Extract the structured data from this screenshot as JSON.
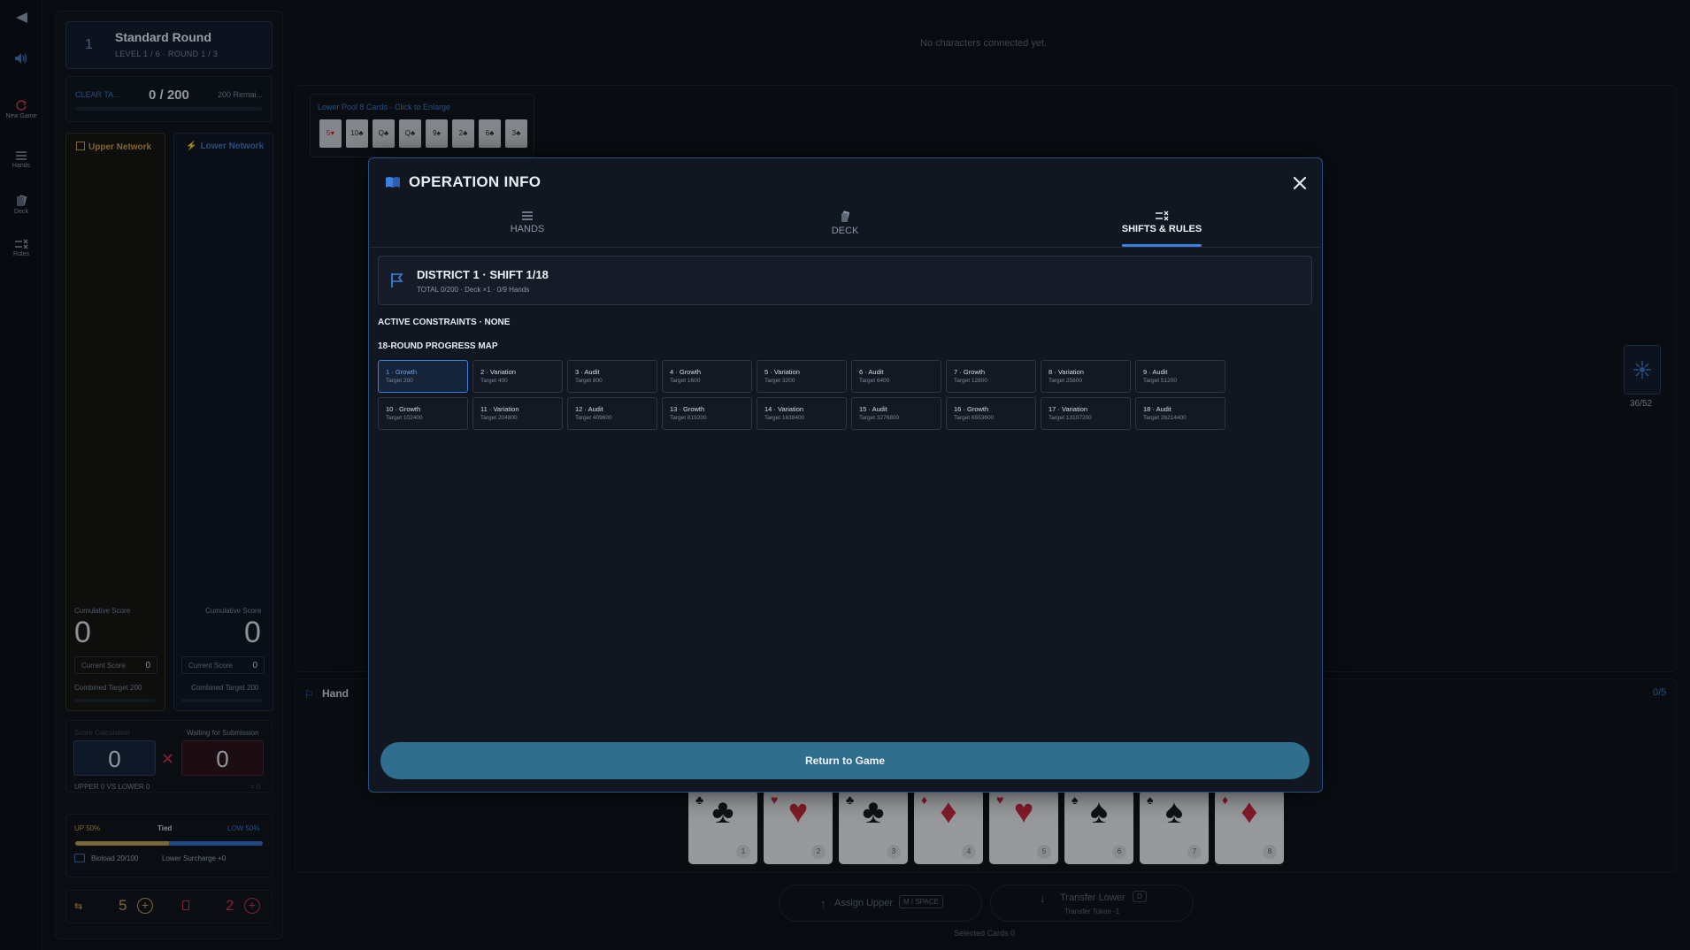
{
  "rail": [
    {
      "icon": "back-arrow-icon",
      "label": ""
    },
    {
      "icon": "volume-icon",
      "label": ""
    },
    {
      "icon": "new-game-icon",
      "label": "New Game"
    },
    {
      "icon": "hands-icon",
      "label": "Hands"
    },
    {
      "icon": "deck-icon",
      "label": "Deck"
    },
    {
      "icon": "rules-icon",
      "label": "Rules"
    }
  ],
  "round": {
    "number": "1",
    "title": "Standard Round",
    "subtitle": "LEVEL 1 / 6 · ROUND 1 / 3"
  },
  "target": {
    "label": "CLEAR TA...",
    "value": "0 / 200",
    "remaining": "200 Remai..."
  },
  "networks": {
    "upper": {
      "title": "Upper Network",
      "cum_label": "Cumulative Score",
      "cum_value": "0",
      "current_label": "Current Score",
      "current_value": "0",
      "combined": "Combined Target 200"
    },
    "lower": {
      "title": "Lower Network",
      "cum_label": "Cumulative Score",
      "cum_value": "0",
      "current_label": "Current Score",
      "current_value": "0",
      "combined": "Combined Target 200"
    }
  },
  "calc": {
    "label": "Score Calculation",
    "status": "Waiting for Submission",
    "left_value": "0",
    "right_value": "0",
    "vs_text": "UPPER 0  VS  LOWER 0",
    "right_small": "= 0"
  },
  "sway": {
    "up_label": "UP 50%",
    "mid_label": "Tied",
    "low_label": "LOW 50%",
    "up_fraction": 0.5,
    "bioload": "Bioload 20/100",
    "surcharge": "Lower Surcharge +0"
  },
  "resources": {
    "left_value": "5",
    "right_value": "2"
  },
  "board": {
    "no_chars": "No characters connected yet.",
    "pool_title": "Lower Pool 8 Cards · Click to Enlarge",
    "pool_cards": [
      "5♥",
      "10♣",
      "Q♣",
      "Q♣",
      "9♠",
      "2♣",
      "6♣",
      "3♣"
    ],
    "deck_count": "36/52",
    "hand_title": "Hand",
    "hand_count": "0/5",
    "assign_label": "Assign Upper",
    "assign_key": "M / SPACE",
    "transfer_label": "Transfer Lower",
    "transfer_key": "D",
    "transfer_sub": "Transfer Token -1",
    "selected": "Selected Cards 0"
  },
  "hand_cards": [
    {
      "suit": "♣",
      "color": "black",
      "index": "1"
    },
    {
      "suit": "♥",
      "color": "red",
      "index": "2"
    },
    {
      "suit": "♣",
      "color": "black",
      "index": "3"
    },
    {
      "suit": "♦",
      "color": "red",
      "index": "4"
    },
    {
      "suit": "♥",
      "color": "red",
      "index": "5"
    },
    {
      "suit": "♠",
      "color": "black",
      "index": "6"
    },
    {
      "suit": "♠",
      "color": "black",
      "index": "7"
    },
    {
      "suit": "♦",
      "color": "red",
      "index": "8"
    }
  ],
  "modal": {
    "title": "OPERATION INFO",
    "tabs": [
      {
        "label": "HANDS",
        "icon": "list-icon"
      },
      {
        "label": "DECK",
        "icon": "cards-icon"
      },
      {
        "label": "SHIFTS & RULES",
        "icon": "rules-icon"
      }
    ],
    "active_tab": 2,
    "district_title": "DISTRICT 1 · SHIFT 1/18",
    "district_sub": "TOTAL 0/200 · Deck ×1 · 0/9 Hands",
    "constraints": "ACTIVE CONSTRAINTS · NONE",
    "progress_title": "18-ROUND PROGRESS MAP",
    "return_label": "Return to Game",
    "shifts": [
      {
        "name": "1 · Growth",
        "target": "Target 200"
      },
      {
        "name": "2 · Variation",
        "target": "Target 400"
      },
      {
        "name": "3 · Audit",
        "target": "Target 800"
      },
      {
        "name": "4 · Growth",
        "target": "Target 1600"
      },
      {
        "name": "5 · Variation",
        "target": "Target 3200"
      },
      {
        "name": "6 · Audit",
        "target": "Target 6400"
      },
      {
        "name": "7 · Growth",
        "target": "Target 12800"
      },
      {
        "name": "8 · Variation",
        "target": "Target 25600"
      },
      {
        "name": "9 · Audit",
        "target": "Target 51200"
      },
      {
        "name": "10 · Growth",
        "target": "Target 102400"
      },
      {
        "name": "11 · Variation",
        "target": "Target 204800"
      },
      {
        "name": "12 · Audit",
        "target": "Target 409600"
      },
      {
        "name": "13 · Growth",
        "target": "Target 819200"
      },
      {
        "name": "14 · Variation",
        "target": "Target 1638400"
      },
      {
        "name": "15 · Audit",
        "target": "Target 3276800"
      },
      {
        "name": "16 · Growth",
        "target": "Target 6553600"
      },
      {
        "name": "17 · Variation",
        "target": "Target 13107200"
      },
      {
        "name": "18 · Audit",
        "target": "Target 26214400"
      }
    ]
  },
  "colors": {
    "accent": "#3d7fe0",
    "upper": "#b89a54",
    "lower": "#2f6ec4",
    "danger": "#c9314a",
    "button": "#2f6e8c"
  }
}
